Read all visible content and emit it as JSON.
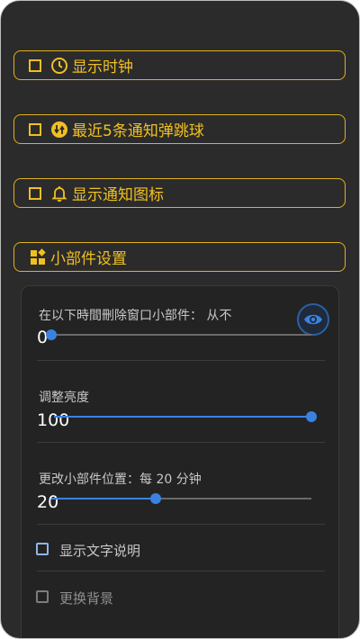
{
  "toggles": [
    {
      "label": "显示时钟",
      "icon": "clock-icon"
    },
    {
      "label": "最近5条通知弹跳球",
      "icon": "circle-arrows-icon"
    },
    {
      "label": "显示通知图标",
      "icon": "bell-icon"
    },
    {
      "label": "小部件设置",
      "icon": "widgets-icon"
    }
  ],
  "settings": {
    "delete_widget": {
      "label": "在以下時間刪除窗口小部件： 从不",
      "value": "0",
      "fraction": 0.0
    },
    "brightness": {
      "label": "调整亮度",
      "value": "100",
      "fraction": 1.0
    },
    "position": {
      "label": "更改小部件位置：每 20 分钟",
      "value": "20",
      "fraction": 0.4
    },
    "show_caption": {
      "label": "显示文字说明",
      "checked": false
    },
    "change_bg": {
      "label": "更换背景",
      "checked": false
    }
  },
  "colors": {
    "accent": "#f0c020",
    "slider": "#3b82e0",
    "background": "#2b2b2b"
  }
}
